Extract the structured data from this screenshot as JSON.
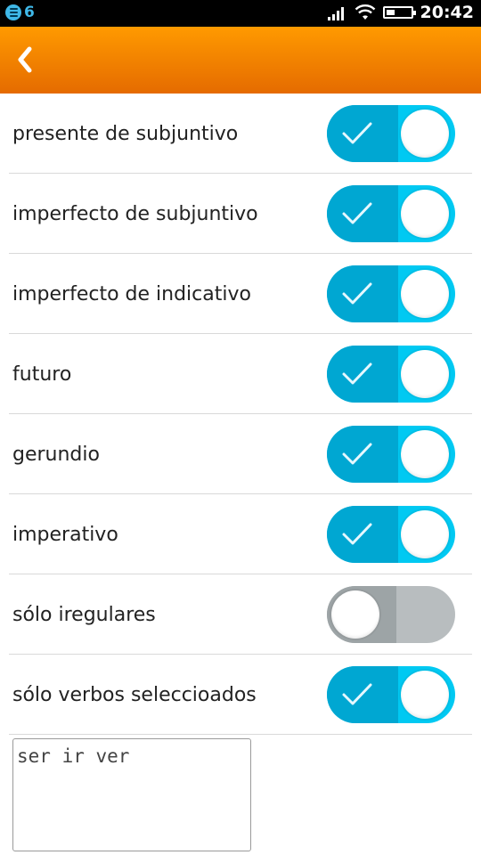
{
  "status_bar": {
    "notification_count": "6",
    "time": "20:42",
    "icons": [
      "notification-icon",
      "signal-icon",
      "wifi-icon",
      "battery-icon"
    ],
    "battery_level": 0.35
  },
  "header": {
    "back_icon": "chevron-left-icon",
    "color_top": "#ff9a00",
    "color_bottom": "#e56b00"
  },
  "settings": [
    {
      "label": "presente de subjuntivo",
      "enabled": true
    },
    {
      "label": "imperfecto de subjuntivo",
      "enabled": true
    },
    {
      "label": "imperfecto de indicativo",
      "enabled": true
    },
    {
      "label": "futuro",
      "enabled": true
    },
    {
      "label": "gerundio",
      "enabled": true
    },
    {
      "label": "imperativo",
      "enabled": true
    },
    {
      "label": "sólo iregulares",
      "enabled": false
    },
    {
      "label": "sólo verbos seleccioados",
      "enabled": true
    }
  ],
  "verbs_input": {
    "value": "ser ir ver"
  },
  "colors": {
    "toggle_on": "#00c9f2",
    "toggle_on_dark": "#00a7d2",
    "toggle_off": "#b8bdbf"
  }
}
